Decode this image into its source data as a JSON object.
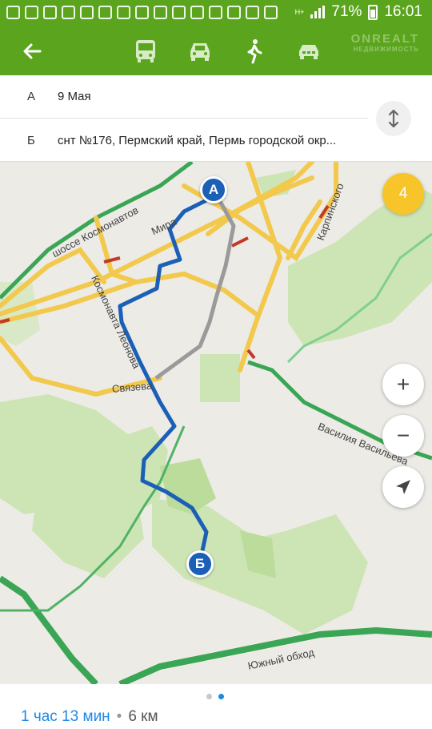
{
  "status_bar": {
    "battery": "71%",
    "time": "16:01",
    "network": "H+",
    "notification_icons": [
      "mail-icon",
      "vk-icon",
      "messenger-icon",
      "youtube-icon",
      "youtube-icon",
      "gallery-icon",
      "cloud-icon",
      "cloud-icon",
      "cloud-icon",
      "mail-icon",
      "download-icon",
      "download-icon",
      "download-icon",
      "download-icon",
      "download-icon"
    ]
  },
  "watermark": {
    "brand": "ONREALT",
    "subtitle": "НЕДВИЖИМОСТЬ"
  },
  "toolbar": {
    "modes": [
      "bus-icon",
      "car-icon",
      "walk-icon",
      "taxi-icon"
    ]
  },
  "route": {
    "from_letter": "А",
    "from": "9 Мая",
    "to_letter": "Б",
    "to": "снт №176, Пермский край, Пермь городской окр..."
  },
  "map": {
    "traffic_level": "4",
    "marker_start": "А",
    "marker_end": "Б",
    "streets": {
      "kosmonavtov": "шоссе Космонавтов",
      "mira": "Мира",
      "leonova": "Космонавта Леонова",
      "karpinskogo": "Карпинского",
      "svyazeva": "Связева",
      "vasiliya": "Василия Васильева",
      "yuzhny": "Южный обход"
    },
    "zoom_in": "+",
    "zoom_out": "−"
  },
  "summary": {
    "duration": "1 час 13 мин",
    "separator": "•",
    "distance": "6 км",
    "pages": 2,
    "active_page": 2
  },
  "colors": {
    "brand_green": "#5aa51d",
    "route_blue": "#1b5fb6",
    "traffic_yellow": "#f7c52a",
    "road_yellow": "#f2c94c",
    "road_green": "#3aa655",
    "road_red": "#c0392b"
  }
}
